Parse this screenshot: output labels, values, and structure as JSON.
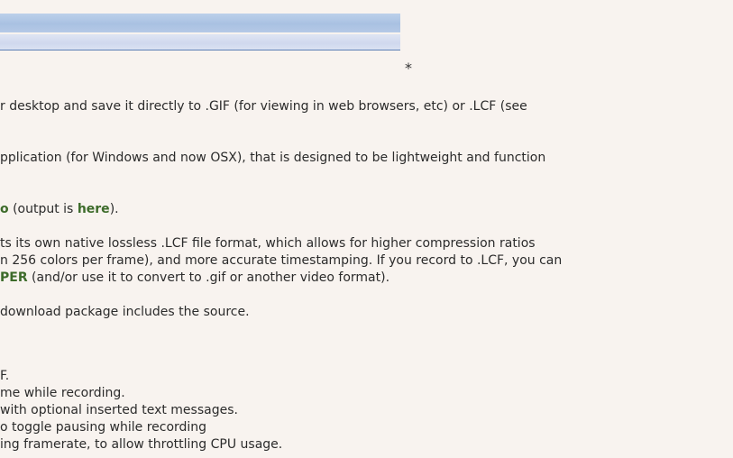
{
  "header": {
    "asterisk": "*"
  },
  "intro": {
    "line1": "r desktop and save it directly to .GIF (for viewing in web browsers, etc) or .LCF (see",
    "line2": "pplication (for Windows and now OSX), that is designed to be lightweight and function"
  },
  "demo": {
    "link_tail": "o",
    "text_before": " (output is ",
    "here_link": "here",
    "text_after": ")."
  },
  "lcf": {
    "line1": "ts its own native lossless .LCF file format, which allows for higher compression ratios",
    "line2": "n 256 colors per frame), and more accurate timestamping. If you record to .LCF, you can",
    "link_tail": "PER",
    "line3_rest": " (and/or use it to convert to .gif or another video format)."
  },
  "source": {
    "line": "download package includes the source."
  },
  "features": [
    "F.",
    "me while recording.",
    " with optional inserted text messages.",
    "o toggle pausing while recording",
    "ing framerate, to allow throttling CPU usage."
  ]
}
